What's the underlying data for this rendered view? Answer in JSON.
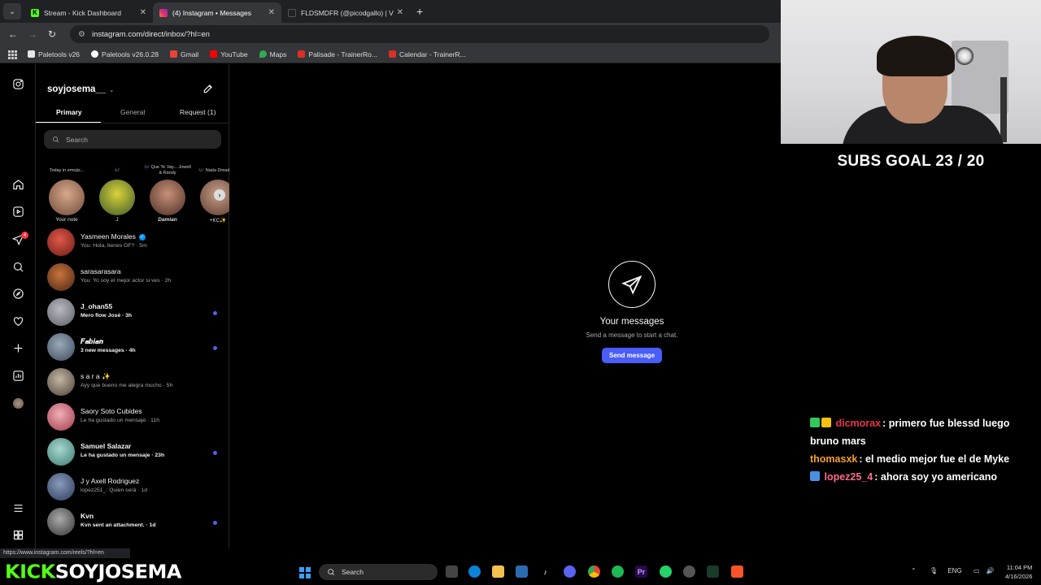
{
  "browser": {
    "tabs": [
      {
        "title": "Stream - Kick Dashboard",
        "icon": "kick-icon",
        "color": "#53fc18"
      },
      {
        "title": "(4) Instagram • Messages",
        "icon": "instagram-icon",
        "color": "#e1306c"
      },
      {
        "title": "FLDSMDFR (@picodgallo) | VSC",
        "icon": "vsco-icon",
        "color": "#222222"
      }
    ],
    "new_tab": "+",
    "url": "instagram.com/direct/inbox/?hl=en",
    "bookmarks": [
      {
        "label": "Paletools v26",
        "icon": "paletools-icon",
        "color": "#e6e6e6"
      },
      {
        "label": "Paletools v26.0.28",
        "icon": "paletools-icon",
        "color": "#ffffff"
      },
      {
        "label": "Gmail",
        "icon": "gmail-icon",
        "color": "#ea4335"
      },
      {
        "label": "YouTube",
        "icon": "youtube-icon",
        "color": "#ff0000"
      },
      {
        "label": "Maps",
        "icon": "maps-icon",
        "color": "#34a853"
      },
      {
        "label": "Palisade - TrainerRo...",
        "icon": "trainer-icon",
        "color": "#d93025"
      },
      {
        "label": "Calendar - TrainerR...",
        "icon": "trainer-icon",
        "color": "#d93025"
      }
    ],
    "status_url": "https://www.instagram.com/reels/?hl=en"
  },
  "instagram": {
    "username": "soyjosema__",
    "tabs": {
      "primary": "Primary",
      "general": "General",
      "request": "Request (1)"
    },
    "search_placeholder": "Search",
    "notes": [
      {
        "bubble": "Today in emojis...",
        "name": "Your note",
        "color": "#b3876b"
      },
      {
        "bubble": "🎶",
        "name": "J",
        "color": "#5a7a3a"
      },
      {
        "bubble": "🎶 Que Te Vay... Jowell & Randy",
        "name": "Damian",
        "color": "#6b4a3a"
      },
      {
        "bubble": "🎶 Nada Dread Ma",
        "name": "+KC✨",
        "color": "#8a6a5a"
      }
    ],
    "threads": [
      {
        "name": "Yasmeen Morales",
        "preview": "You: Hola, tienes OF? · 5m",
        "unread": false,
        "verified": true,
        "color": "#c0392b"
      },
      {
        "name": "sarasarasara",
        "preview": "You: Yo soy el mejor actor si ves · 2h",
        "unread": false,
        "verified": false,
        "color": "#a0522d"
      },
      {
        "name": "J_ohan55",
        "preview": "Mero flow José · 3h",
        "unread": true,
        "verified": false,
        "color": "#8a8f96"
      },
      {
        "name": "𝑭𝒂𝒃𝒊𝒂𝒏",
        "preview": "3 new messages · 4h",
        "unread": true,
        "verified": false,
        "color": "#6a7a8a"
      },
      {
        "name": "s a r a ✨",
        "preview": "Ayy que bueno me alegra mucho · 5h",
        "unread": false,
        "verified": false,
        "color": "#9a8f80"
      },
      {
        "name": "Saory Soto Cubides",
        "preview": "Le ha gustado un mensaje · 11h",
        "unread": false,
        "verified": false,
        "color": "#d06070"
      },
      {
        "name": "Samuel Salazar",
        "preview": "Le ha gustado un mensaje · 23h",
        "unread": true,
        "verified": false,
        "color": "#7ab0a8"
      },
      {
        "name": "J y Axell Rodriguez",
        "preview": "lopez251_: Quien será · 1d",
        "unread": false,
        "verified": false,
        "color": "#5a6a8a"
      },
      {
        "name": "Kvn",
        "preview": "Kvn sent an attachment. · 1d",
        "unread": true,
        "verified": false,
        "color": "#777777"
      }
    ],
    "main": {
      "title": "Your messages",
      "subtitle": "Send a message to start a chat.",
      "button": "Send message"
    },
    "notification_count": "4"
  },
  "stream": {
    "subs_goal": "SUBS GOAL 23 / 20",
    "chat": [
      {
        "user": "dicmorax",
        "user_color": "#e8354b",
        "message": ": primero fue blessd luego bruno mars",
        "badges": [
          "#35c759",
          "#f4c20d"
        ]
      },
      {
        "user": "thomasxk",
        "user_color": "#f59e2c",
        "message": ": el medio mejor fue el de Myke",
        "badges": []
      },
      {
        "user": "lopez25_4",
        "user_color": "#ff6b8a",
        "message": ": ahora soy yo americano",
        "badges": [
          "#4a90e2"
        ]
      }
    ],
    "brand": "KICK",
    "channel": "SOYJOSEMA"
  },
  "taskbar": {
    "search": "Search",
    "lang": "ENG",
    "time": "11:04 PM",
    "date": "4/16/2026"
  },
  "accent": "#4a5df9"
}
